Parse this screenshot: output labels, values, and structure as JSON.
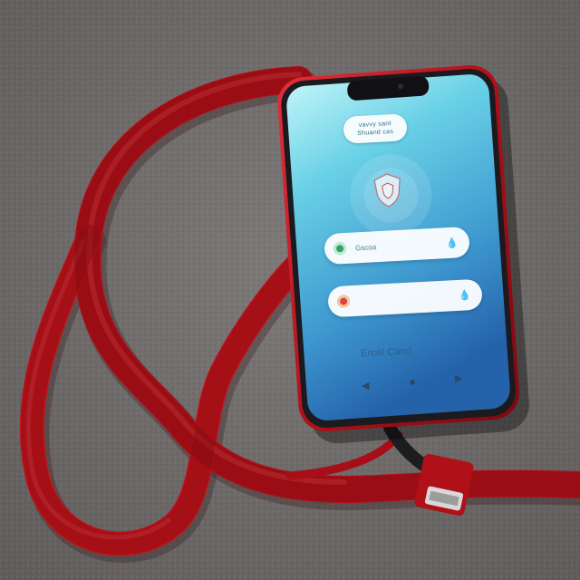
{
  "photo": {
    "subject": "red smartphone with red braided lanyard cord on gray concrete",
    "colors": {
      "concrete": "#6f6c6b",
      "cord": "#c8141e",
      "case": "#c01620",
      "screen_top": "#a9ecf4",
      "screen_bottom": "#2a73b8"
    }
  },
  "phone_screen": {
    "top_pill": {
      "line1": "vavvy sant",
      "line2": "Shuand cas"
    },
    "shield_icon": "shield-icon",
    "bars": [
      {
        "label": "Gscoa",
        "dot_color": "#2fa26b",
        "accent_color": "#2a7fa8",
        "icon": "droplet-icon"
      },
      {
        "label": "",
        "dot_color": "#d8453c",
        "accent_color": "#c23b4a",
        "icon": "droplet-icon"
      }
    ],
    "footer_text": "Ercel Cand",
    "nav": {
      "back": "◀",
      "home": "■",
      "recents": "▶"
    }
  }
}
